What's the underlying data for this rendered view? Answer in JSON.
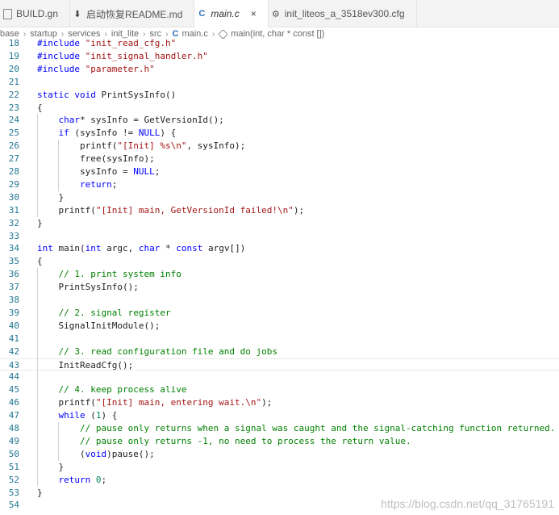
{
  "tabs": [
    {
      "label": "BUILD.gn",
      "icon": "file-icon",
      "active": false
    },
    {
      "label": "启动恢复README.md",
      "icon": "download-icon",
      "active": false
    },
    {
      "label": "main.c",
      "icon": "c-file-icon",
      "active": true,
      "close": "×"
    },
    {
      "label": "init_liteos_a_3518ev300.cfg",
      "icon": "gear-icon",
      "active": false
    }
  ],
  "breadcrumb": [
    "base",
    "startup",
    "services",
    "init_lite",
    "src",
    "main.c",
    "main(int, char * const [])"
  ],
  "editor": {
    "current_line": 43,
    "lines": [
      {
        "n": "18",
        "code": "#include \"init_read_cfg.h\""
      },
      {
        "n": "19",
        "code": "#include \"init_signal_handler.h\""
      },
      {
        "n": "20",
        "code": "#include \"parameter.h\""
      },
      {
        "n": "21",
        "code": ""
      },
      {
        "n": "22",
        "code": "static void PrintSysInfo()"
      },
      {
        "n": "23",
        "code": "{"
      },
      {
        "n": "24",
        "code": "    char* sysInfo = GetVersionId();"
      },
      {
        "n": "25",
        "code": "    if (sysInfo != NULL) {"
      },
      {
        "n": "26",
        "code": "        printf(\"[Init] %s\\n\", sysInfo);"
      },
      {
        "n": "27",
        "code": "        free(sysInfo);"
      },
      {
        "n": "28",
        "code": "        sysInfo = NULL;"
      },
      {
        "n": "29",
        "code": "        return;"
      },
      {
        "n": "30",
        "code": "    }"
      },
      {
        "n": "31",
        "code": "    printf(\"[Init] main, GetVersionId failed!\\n\");"
      },
      {
        "n": "32",
        "code": "}"
      },
      {
        "n": "33",
        "code": ""
      },
      {
        "n": "34",
        "code": "int main(int argc, char * const argv[])"
      },
      {
        "n": "35",
        "code": "{"
      },
      {
        "n": "36",
        "code": "    // 1. print system info"
      },
      {
        "n": "37",
        "code": "    PrintSysInfo();"
      },
      {
        "n": "38",
        "code": ""
      },
      {
        "n": "39",
        "code": "    // 2. signal register"
      },
      {
        "n": "40",
        "code": "    SignalInitModule();"
      },
      {
        "n": "41",
        "code": ""
      },
      {
        "n": "42",
        "code": "    // 3. read configuration file and do jobs"
      },
      {
        "n": "43",
        "code": "    InitReadCfg();"
      },
      {
        "n": "44",
        "code": ""
      },
      {
        "n": "45",
        "code": "    // 4. keep process alive"
      },
      {
        "n": "46",
        "code": "    printf(\"[Init] main, entering wait.\\n\");"
      },
      {
        "n": "47",
        "code": "    while (1) {"
      },
      {
        "n": "48",
        "code": "        // pause only returns when a signal was caught and the signal-catching function returned."
      },
      {
        "n": "49",
        "code": "        // pause only returns -1, no need to process the return value."
      },
      {
        "n": "50",
        "code": "        (void)pause();"
      },
      {
        "n": "51",
        "code": "    }"
      },
      {
        "n": "52",
        "code": "    return 0;"
      },
      {
        "n": "53",
        "code": "}"
      },
      {
        "n": "54",
        "code": ""
      }
    ]
  },
  "watermark": "https://blog.csdn.net/qq_31765191",
  "colors": {
    "keyword": "#0000ff",
    "string": "#a31515",
    "comment": "#008000",
    "number": "#098658",
    "line_number": "#237893"
  }
}
